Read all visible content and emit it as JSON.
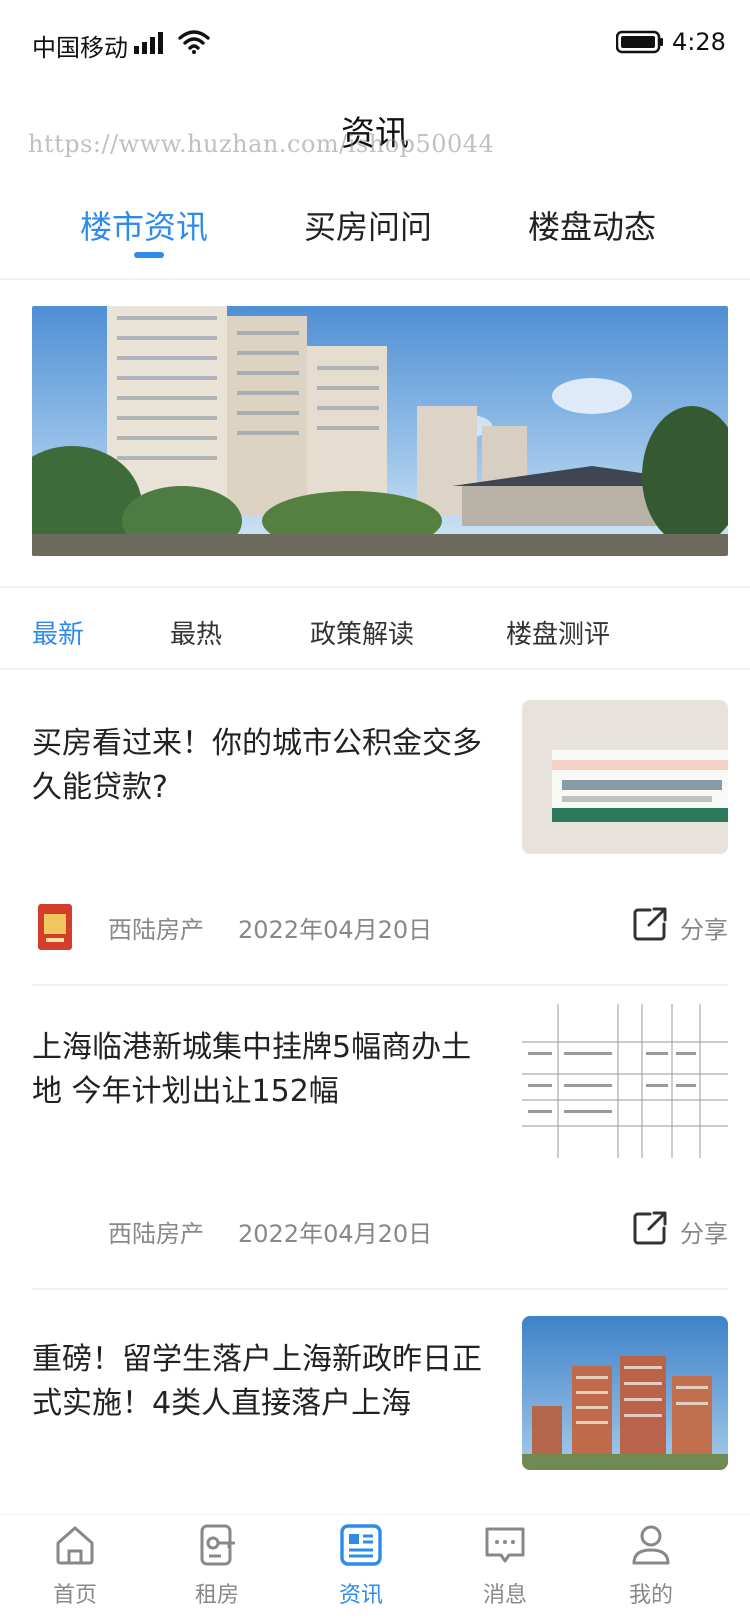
{
  "status_bar": {
    "carrier": "中国移动",
    "time": "4:28",
    "icons": [
      "signal-icon",
      "wifi-icon",
      "battery-icon"
    ]
  },
  "header": {
    "title": "资讯",
    "watermark": "https://www.huzhan.com/ishop50044"
  },
  "main_tabs": [
    {
      "label": "楼市资讯",
      "active": true
    },
    {
      "label": "买房问问",
      "active": false
    },
    {
      "label": "楼盘动态",
      "active": false
    }
  ],
  "sub_tabs": [
    {
      "label": "最新",
      "active": true
    },
    {
      "label": "最热",
      "active": false
    },
    {
      "label": "政策解读",
      "active": false
    },
    {
      "label": "楼盘测评",
      "active": false
    }
  ],
  "articles": [
    {
      "title": "买房看过来！你的城市公积金交多久能贷款?",
      "source": "西陆房产",
      "date": "2022年04月20日",
      "share": "分享",
      "thumb": "medicine-box"
    },
    {
      "title": "上海临港新城集中挂牌5幅商办土地 今年计划出让152幅",
      "source": "西陆房产",
      "date": "2022年04月20日",
      "share": "分享",
      "thumb": "table-document"
    },
    {
      "title": "重磅！留学生落户上海新政昨日正式实施！4类人直接落户上海",
      "thumb": "apartment-buildings"
    }
  ],
  "bottom_nav": [
    {
      "label": "首页",
      "icon": "home-icon",
      "active": false
    },
    {
      "label": "租房",
      "icon": "rent-icon",
      "active": false
    },
    {
      "label": "资讯",
      "icon": "news-icon",
      "active": true
    },
    {
      "label": "消息",
      "icon": "message-icon",
      "active": false
    },
    {
      "label": "我的",
      "icon": "user-icon",
      "active": false
    }
  ],
  "colors": {
    "accent": "#2e8ce8",
    "text": "#222222",
    "muted": "#888888"
  }
}
